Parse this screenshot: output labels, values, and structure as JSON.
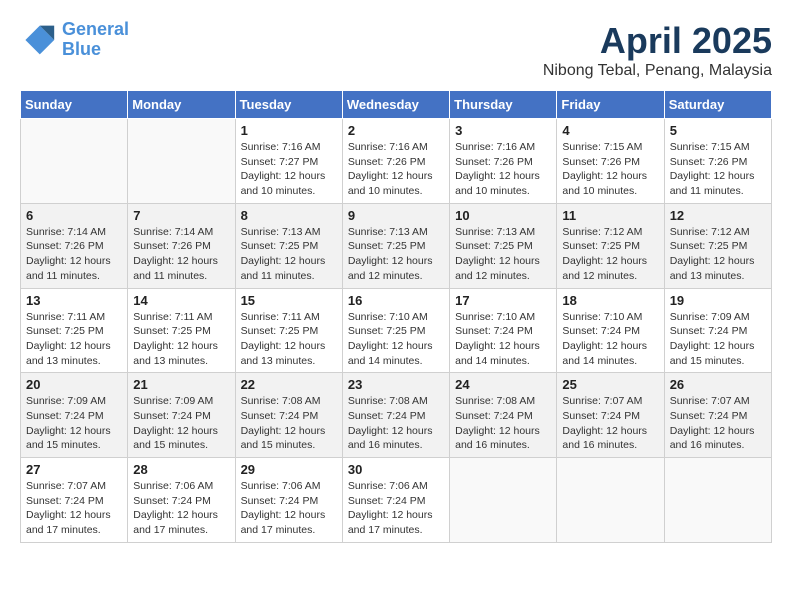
{
  "header": {
    "logo_line1": "General",
    "logo_line2": "Blue",
    "title": "April 2025",
    "subtitle": "Nibong Tebal, Penang, Malaysia"
  },
  "weekdays": [
    "Sunday",
    "Monday",
    "Tuesday",
    "Wednesday",
    "Thursday",
    "Friday",
    "Saturday"
  ],
  "weeks": [
    [
      {
        "day": "",
        "sunrise": "",
        "sunset": "",
        "daylight": ""
      },
      {
        "day": "",
        "sunrise": "",
        "sunset": "",
        "daylight": ""
      },
      {
        "day": "1",
        "sunrise": "Sunrise: 7:16 AM",
        "sunset": "Sunset: 7:27 PM",
        "daylight": "Daylight: 12 hours and 10 minutes."
      },
      {
        "day": "2",
        "sunrise": "Sunrise: 7:16 AM",
        "sunset": "Sunset: 7:26 PM",
        "daylight": "Daylight: 12 hours and 10 minutes."
      },
      {
        "day": "3",
        "sunrise": "Sunrise: 7:16 AM",
        "sunset": "Sunset: 7:26 PM",
        "daylight": "Daylight: 12 hours and 10 minutes."
      },
      {
        "day": "4",
        "sunrise": "Sunrise: 7:15 AM",
        "sunset": "Sunset: 7:26 PM",
        "daylight": "Daylight: 12 hours and 10 minutes."
      },
      {
        "day": "5",
        "sunrise": "Sunrise: 7:15 AM",
        "sunset": "Sunset: 7:26 PM",
        "daylight": "Daylight: 12 hours and 11 minutes."
      }
    ],
    [
      {
        "day": "6",
        "sunrise": "Sunrise: 7:14 AM",
        "sunset": "Sunset: 7:26 PM",
        "daylight": "Daylight: 12 hours and 11 minutes."
      },
      {
        "day": "7",
        "sunrise": "Sunrise: 7:14 AM",
        "sunset": "Sunset: 7:26 PM",
        "daylight": "Daylight: 12 hours and 11 minutes."
      },
      {
        "day": "8",
        "sunrise": "Sunrise: 7:13 AM",
        "sunset": "Sunset: 7:25 PM",
        "daylight": "Daylight: 12 hours and 11 minutes."
      },
      {
        "day": "9",
        "sunrise": "Sunrise: 7:13 AM",
        "sunset": "Sunset: 7:25 PM",
        "daylight": "Daylight: 12 hours and 12 minutes."
      },
      {
        "day": "10",
        "sunrise": "Sunrise: 7:13 AM",
        "sunset": "Sunset: 7:25 PM",
        "daylight": "Daylight: 12 hours and 12 minutes."
      },
      {
        "day": "11",
        "sunrise": "Sunrise: 7:12 AM",
        "sunset": "Sunset: 7:25 PM",
        "daylight": "Daylight: 12 hours and 12 minutes."
      },
      {
        "day": "12",
        "sunrise": "Sunrise: 7:12 AM",
        "sunset": "Sunset: 7:25 PM",
        "daylight": "Daylight: 12 hours and 13 minutes."
      }
    ],
    [
      {
        "day": "13",
        "sunrise": "Sunrise: 7:11 AM",
        "sunset": "Sunset: 7:25 PM",
        "daylight": "Daylight: 12 hours and 13 minutes."
      },
      {
        "day": "14",
        "sunrise": "Sunrise: 7:11 AM",
        "sunset": "Sunset: 7:25 PM",
        "daylight": "Daylight: 12 hours and 13 minutes."
      },
      {
        "day": "15",
        "sunrise": "Sunrise: 7:11 AM",
        "sunset": "Sunset: 7:25 PM",
        "daylight": "Daylight: 12 hours and 13 minutes."
      },
      {
        "day": "16",
        "sunrise": "Sunrise: 7:10 AM",
        "sunset": "Sunset: 7:25 PM",
        "daylight": "Daylight: 12 hours and 14 minutes."
      },
      {
        "day": "17",
        "sunrise": "Sunrise: 7:10 AM",
        "sunset": "Sunset: 7:24 PM",
        "daylight": "Daylight: 12 hours and 14 minutes."
      },
      {
        "day": "18",
        "sunrise": "Sunrise: 7:10 AM",
        "sunset": "Sunset: 7:24 PM",
        "daylight": "Daylight: 12 hours and 14 minutes."
      },
      {
        "day": "19",
        "sunrise": "Sunrise: 7:09 AM",
        "sunset": "Sunset: 7:24 PM",
        "daylight": "Daylight: 12 hours and 15 minutes."
      }
    ],
    [
      {
        "day": "20",
        "sunrise": "Sunrise: 7:09 AM",
        "sunset": "Sunset: 7:24 PM",
        "daylight": "Daylight: 12 hours and 15 minutes."
      },
      {
        "day": "21",
        "sunrise": "Sunrise: 7:09 AM",
        "sunset": "Sunset: 7:24 PM",
        "daylight": "Daylight: 12 hours and 15 minutes."
      },
      {
        "day": "22",
        "sunrise": "Sunrise: 7:08 AM",
        "sunset": "Sunset: 7:24 PM",
        "daylight": "Daylight: 12 hours and 15 minutes."
      },
      {
        "day": "23",
        "sunrise": "Sunrise: 7:08 AM",
        "sunset": "Sunset: 7:24 PM",
        "daylight": "Daylight: 12 hours and 16 minutes."
      },
      {
        "day": "24",
        "sunrise": "Sunrise: 7:08 AM",
        "sunset": "Sunset: 7:24 PM",
        "daylight": "Daylight: 12 hours and 16 minutes."
      },
      {
        "day": "25",
        "sunrise": "Sunrise: 7:07 AM",
        "sunset": "Sunset: 7:24 PM",
        "daylight": "Daylight: 12 hours and 16 minutes."
      },
      {
        "day": "26",
        "sunrise": "Sunrise: 7:07 AM",
        "sunset": "Sunset: 7:24 PM",
        "daylight": "Daylight: 12 hours and 16 minutes."
      }
    ],
    [
      {
        "day": "27",
        "sunrise": "Sunrise: 7:07 AM",
        "sunset": "Sunset: 7:24 PM",
        "daylight": "Daylight: 12 hours and 17 minutes."
      },
      {
        "day": "28",
        "sunrise": "Sunrise: 7:06 AM",
        "sunset": "Sunset: 7:24 PM",
        "daylight": "Daylight: 12 hours and 17 minutes."
      },
      {
        "day": "29",
        "sunrise": "Sunrise: 7:06 AM",
        "sunset": "Sunset: 7:24 PM",
        "daylight": "Daylight: 12 hours and 17 minutes."
      },
      {
        "day": "30",
        "sunrise": "Sunrise: 7:06 AM",
        "sunset": "Sunset: 7:24 PM",
        "daylight": "Daylight: 12 hours and 17 minutes."
      },
      {
        "day": "",
        "sunrise": "",
        "sunset": "",
        "daylight": ""
      },
      {
        "day": "",
        "sunrise": "",
        "sunset": "",
        "daylight": ""
      },
      {
        "day": "",
        "sunrise": "",
        "sunset": "",
        "daylight": ""
      }
    ]
  ]
}
